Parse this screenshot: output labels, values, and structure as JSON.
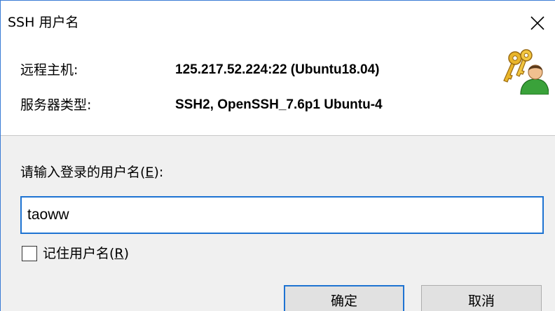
{
  "window": {
    "title": "SSH 用户名"
  },
  "info": {
    "host_label": "远程主机:",
    "host_value": "125.217.52.224:22 (Ubuntu18.04)",
    "server_type_label": "服务器类型:",
    "server_type_value": "SSH2, OpenSSH_7.6p1 Ubuntu-4"
  },
  "form": {
    "prompt_text": "请输入登录的用户名(",
    "prompt_hotkey": "E",
    "prompt_suffix": "):",
    "username_value": "taoww",
    "remember_text": "记住用户名(",
    "remember_hotkey": "R",
    "remember_suffix": ")",
    "remember_checked": false
  },
  "buttons": {
    "ok_label": "确定",
    "cancel_label": "取消"
  },
  "colors": {
    "accent": "#1e73d2",
    "panel": "#ffffff",
    "background": "#f0f0f0"
  },
  "icons": {
    "close": "close-icon",
    "keys": "keys-user-icon"
  }
}
